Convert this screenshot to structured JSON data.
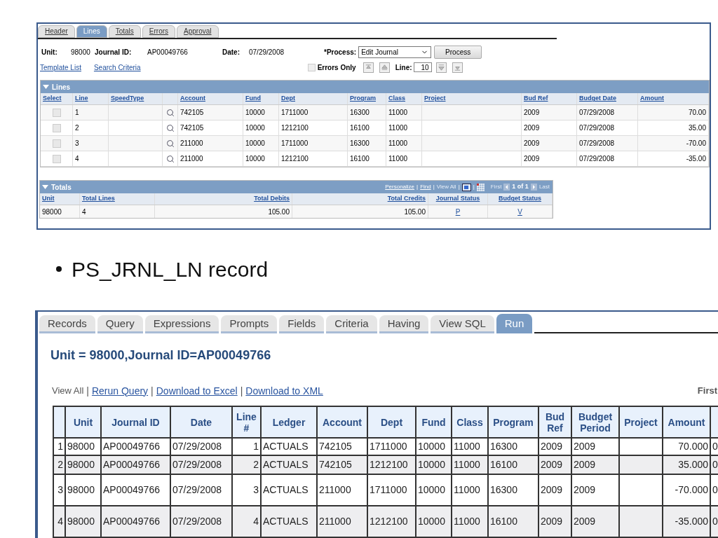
{
  "top_screen": {
    "tabs": [
      {
        "label": "Header",
        "selected": false
      },
      {
        "label": "Lines",
        "selected": true
      },
      {
        "label": "Totals",
        "selected": false
      },
      {
        "label": "Errors",
        "selected": false
      },
      {
        "label": "Approval",
        "selected": false
      }
    ],
    "unit_label": "Unit:",
    "unit": "98000",
    "journal_label": "Journal ID:",
    "journal_id": "AP00049766",
    "date_label": "Date:",
    "date": "07/29/2008",
    "process_label": "*Process:",
    "process_value": "Edit Journal",
    "process_button": "Process",
    "links": [
      "Template List",
      "Search Criteria"
    ],
    "errors_only": {
      "label": "Errors Only",
      "checked": false
    },
    "line_label": "Line:",
    "line_value": "10",
    "lines_grid": {
      "title": "Lines",
      "expanded": true,
      "columns": [
        "Select",
        "Line",
        "SpeedType",
        "",
        "Account",
        "Fund",
        "Dept",
        "Program",
        "Class",
        "Project",
        "Bud Ref",
        "Budget Date",
        "Amount"
      ],
      "rows": [
        {
          "select": false,
          "cells": [
            "",
            "1",
            "",
            "",
            "742105",
            "10000",
            "1711000",
            "16300",
            "11000",
            "",
            "2009",
            "07/29/2008",
            "70.00"
          ]
        },
        {
          "select": false,
          "cells": [
            "",
            "2",
            "",
            "",
            "742105",
            "10000",
            "1212100",
            "16100",
            "11000",
            "",
            "2009",
            "07/29/2008",
            "35.00"
          ]
        },
        {
          "select": false,
          "cells": [
            "",
            "3",
            "",
            "",
            "211000",
            "10000",
            "1711000",
            "16300",
            "11000",
            "",
            "2009",
            "07/29/2008",
            "-70.00"
          ]
        },
        {
          "select": false,
          "cells": [
            "",
            "4",
            "",
            "",
            "211000",
            "10000",
            "1212100",
            "16100",
            "11000",
            "",
            "2009",
            "07/29/2008",
            "-35.00"
          ]
        }
      ]
    },
    "totals_grid": {
      "title": "Totals",
      "expanded": true,
      "separator": "|",
      "personalize": "Personalize",
      "find": "Find",
      "view_all": "View All",
      "first": "First",
      "count": "1 of 1",
      "last": "Last",
      "columns": [
        "Unit",
        "Total Lines",
        "Total Debits",
        "Total Credits",
        "Journal Status",
        "Budget Status"
      ],
      "rows": [
        [
          "98000",
          "4",
          "105.00",
          "105.00",
          "P",
          "V"
        ]
      ]
    }
  },
  "bullet": "PS_JRNL_LN record",
  "bottom_screen": {
    "tabs": [
      {
        "label": "Records",
        "selected": false
      },
      {
        "label": "Query",
        "selected": false
      },
      {
        "label": "Expressions",
        "selected": false
      },
      {
        "label": "Prompts",
        "selected": false
      },
      {
        "label": "Fields",
        "selected": false
      },
      {
        "label": "Criteria",
        "selected": false
      },
      {
        "label": "Having",
        "selected": false
      },
      {
        "label": "View SQL",
        "selected": false
      },
      {
        "label": "Run",
        "selected": true
      }
    ],
    "heading": "Unit = 98000,Journal ID=AP00049766",
    "view_all": "View All",
    "separator": "|",
    "links": [
      "Rerun Query",
      "Download to Excel",
      "Download to XML"
    ],
    "first": "First",
    "columns": [
      "",
      "Unit",
      "Journal ID",
      "Date",
      "Line #",
      "Ledger",
      "Account",
      "Dept",
      "Fund",
      "Class",
      "Program",
      "Bud Ref",
      "Budget Period",
      "Project",
      "Amount",
      ""
    ],
    "rows": [
      [
        "1",
        "98000",
        "AP00049766",
        "07/29/2008",
        "1",
        "ACTUALS",
        "742105",
        "1711000",
        "10000",
        "11000",
        "16300",
        "2009",
        "2009",
        "",
        "70.000",
        "0"
      ],
      [
        "2",
        "98000",
        "AP00049766",
        "07/29/2008",
        "2",
        "ACTUALS",
        "742105",
        "1212100",
        "10000",
        "11000",
        "16100",
        "2009",
        "2009",
        "",
        "35.000",
        "0"
      ],
      [
        "3",
        "98000",
        "AP00049766",
        "07/29/2008",
        "3",
        "ACTUALS",
        "211000",
        "1711000",
        "10000",
        "11000",
        "16300",
        "2009",
        "2009",
        "",
        "-70.000",
        "0"
      ],
      [
        "4",
        "98000",
        "AP00049766",
        "07/29/2008",
        "4",
        "ACTUALS",
        "211000",
        "1212100",
        "10000",
        "11000",
        "16100",
        "2009",
        "2009",
        "",
        "-35.000",
        "0"
      ]
    ]
  }
}
